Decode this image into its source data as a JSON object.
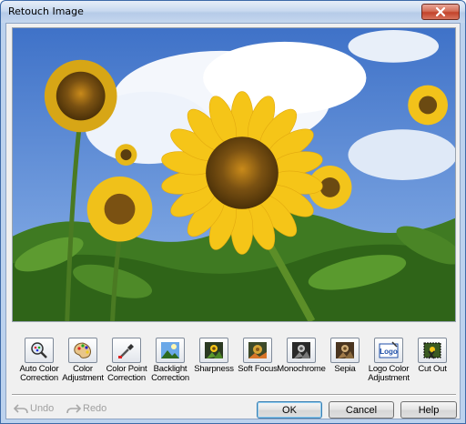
{
  "window": {
    "title": "Retouch Image"
  },
  "preview": {
    "description_icon": "image-preview"
  },
  "tools": [
    {
      "label": "Auto Color\nCorrection",
      "icon": "magnifier-palette-icon"
    },
    {
      "label": "Color\nAdjustment",
      "icon": "palette-icon"
    },
    {
      "label": "Color Point\nCorrection",
      "icon": "eyedropper-icon"
    },
    {
      "label": "Backlight\nCorrection",
      "icon": "backlight-landscape-icon"
    },
    {
      "label": "Sharpness",
      "icon": "sharpness-icon"
    },
    {
      "label": "Soft Focus",
      "icon": "soft-focus-icon"
    },
    {
      "label": "Monochrome",
      "icon": "monochrome-icon"
    },
    {
      "label": "Sepia",
      "icon": "sepia-icon"
    },
    {
      "label": "Logo Color\nAdjustment",
      "icon": "logo-icon"
    },
    {
      "label": "Cut Out",
      "icon": "cut-out-icon"
    }
  ],
  "logo_icon_text": "Logo",
  "footer": {
    "undo_label": "Undo",
    "redo_label": "Redo",
    "ok_label": "OK",
    "cancel_label": "Cancel",
    "help_label": "Help"
  },
  "colors": {
    "sky": "#5b86d4",
    "petal": "#f5c518",
    "center": "#6b4a12",
    "foliage": "#4f8a2a"
  }
}
